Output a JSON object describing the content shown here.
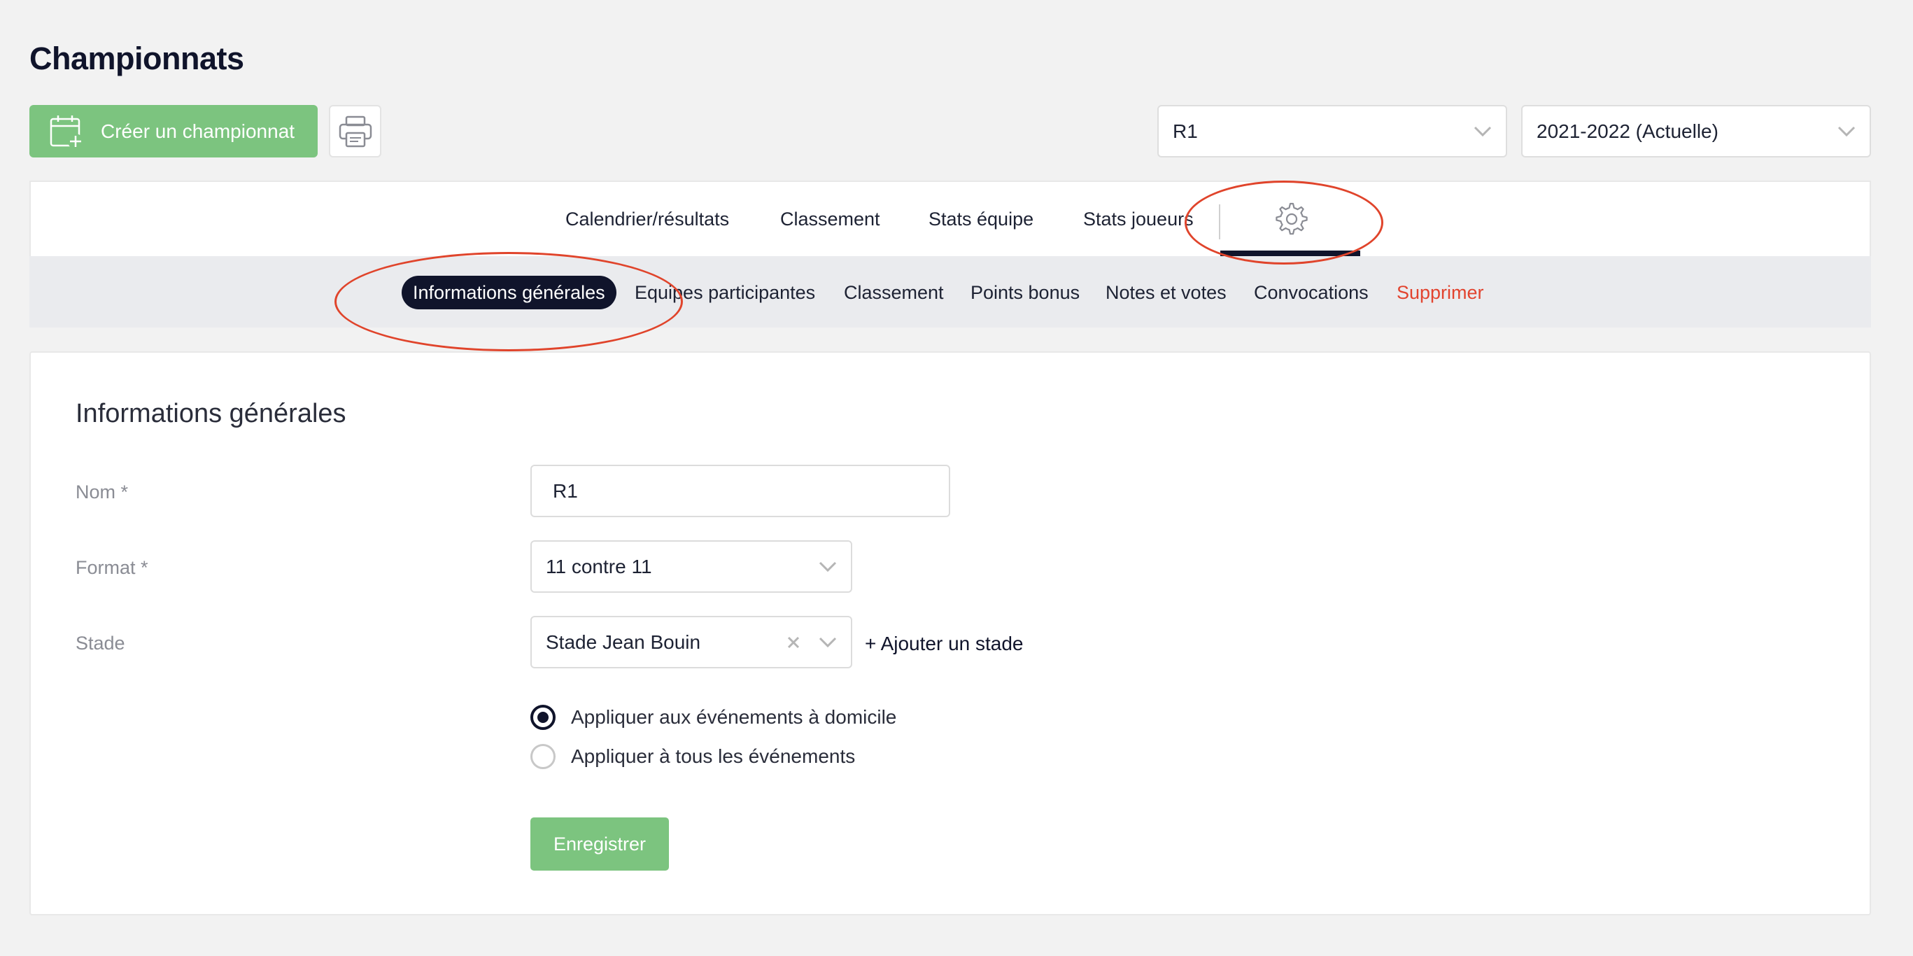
{
  "header": {
    "title": "Championnats",
    "create_label": "Créer un championnat",
    "championship_value": "R1",
    "season_value": "2021-2022 (Actuelle)"
  },
  "tabs": [
    {
      "label": "Calendrier/résultats"
    },
    {
      "label": "Classement"
    },
    {
      "label": "Stats équipe"
    },
    {
      "label": "Stats joueurs"
    }
  ],
  "subtabs": [
    {
      "label": "Informations générales"
    },
    {
      "label": "Equipes participantes"
    },
    {
      "label": "Classement"
    },
    {
      "label": "Points bonus"
    },
    {
      "label": "Notes et votes"
    },
    {
      "label": "Convocations"
    },
    {
      "label": "Supprimer"
    }
  ],
  "form": {
    "section_title": "Informations générales",
    "nom_label": "Nom *",
    "nom_value": "R1",
    "format_label": "Format *",
    "format_value": "11 contre 11",
    "stade_label": "Stade",
    "stade_value": "Stade Jean Bouin",
    "add_stade_label": "+ Ajouter un stade",
    "radio_home": "Appliquer aux événements à domicile",
    "radio_all": "Appliquer à tous les événements",
    "save_label": "Enregistrer"
  },
  "colors": {
    "accent_green": "#7cc47f",
    "dark_navy": "#10142b",
    "danger_red": "#e2442f",
    "annotation_red": "#e0442b"
  }
}
